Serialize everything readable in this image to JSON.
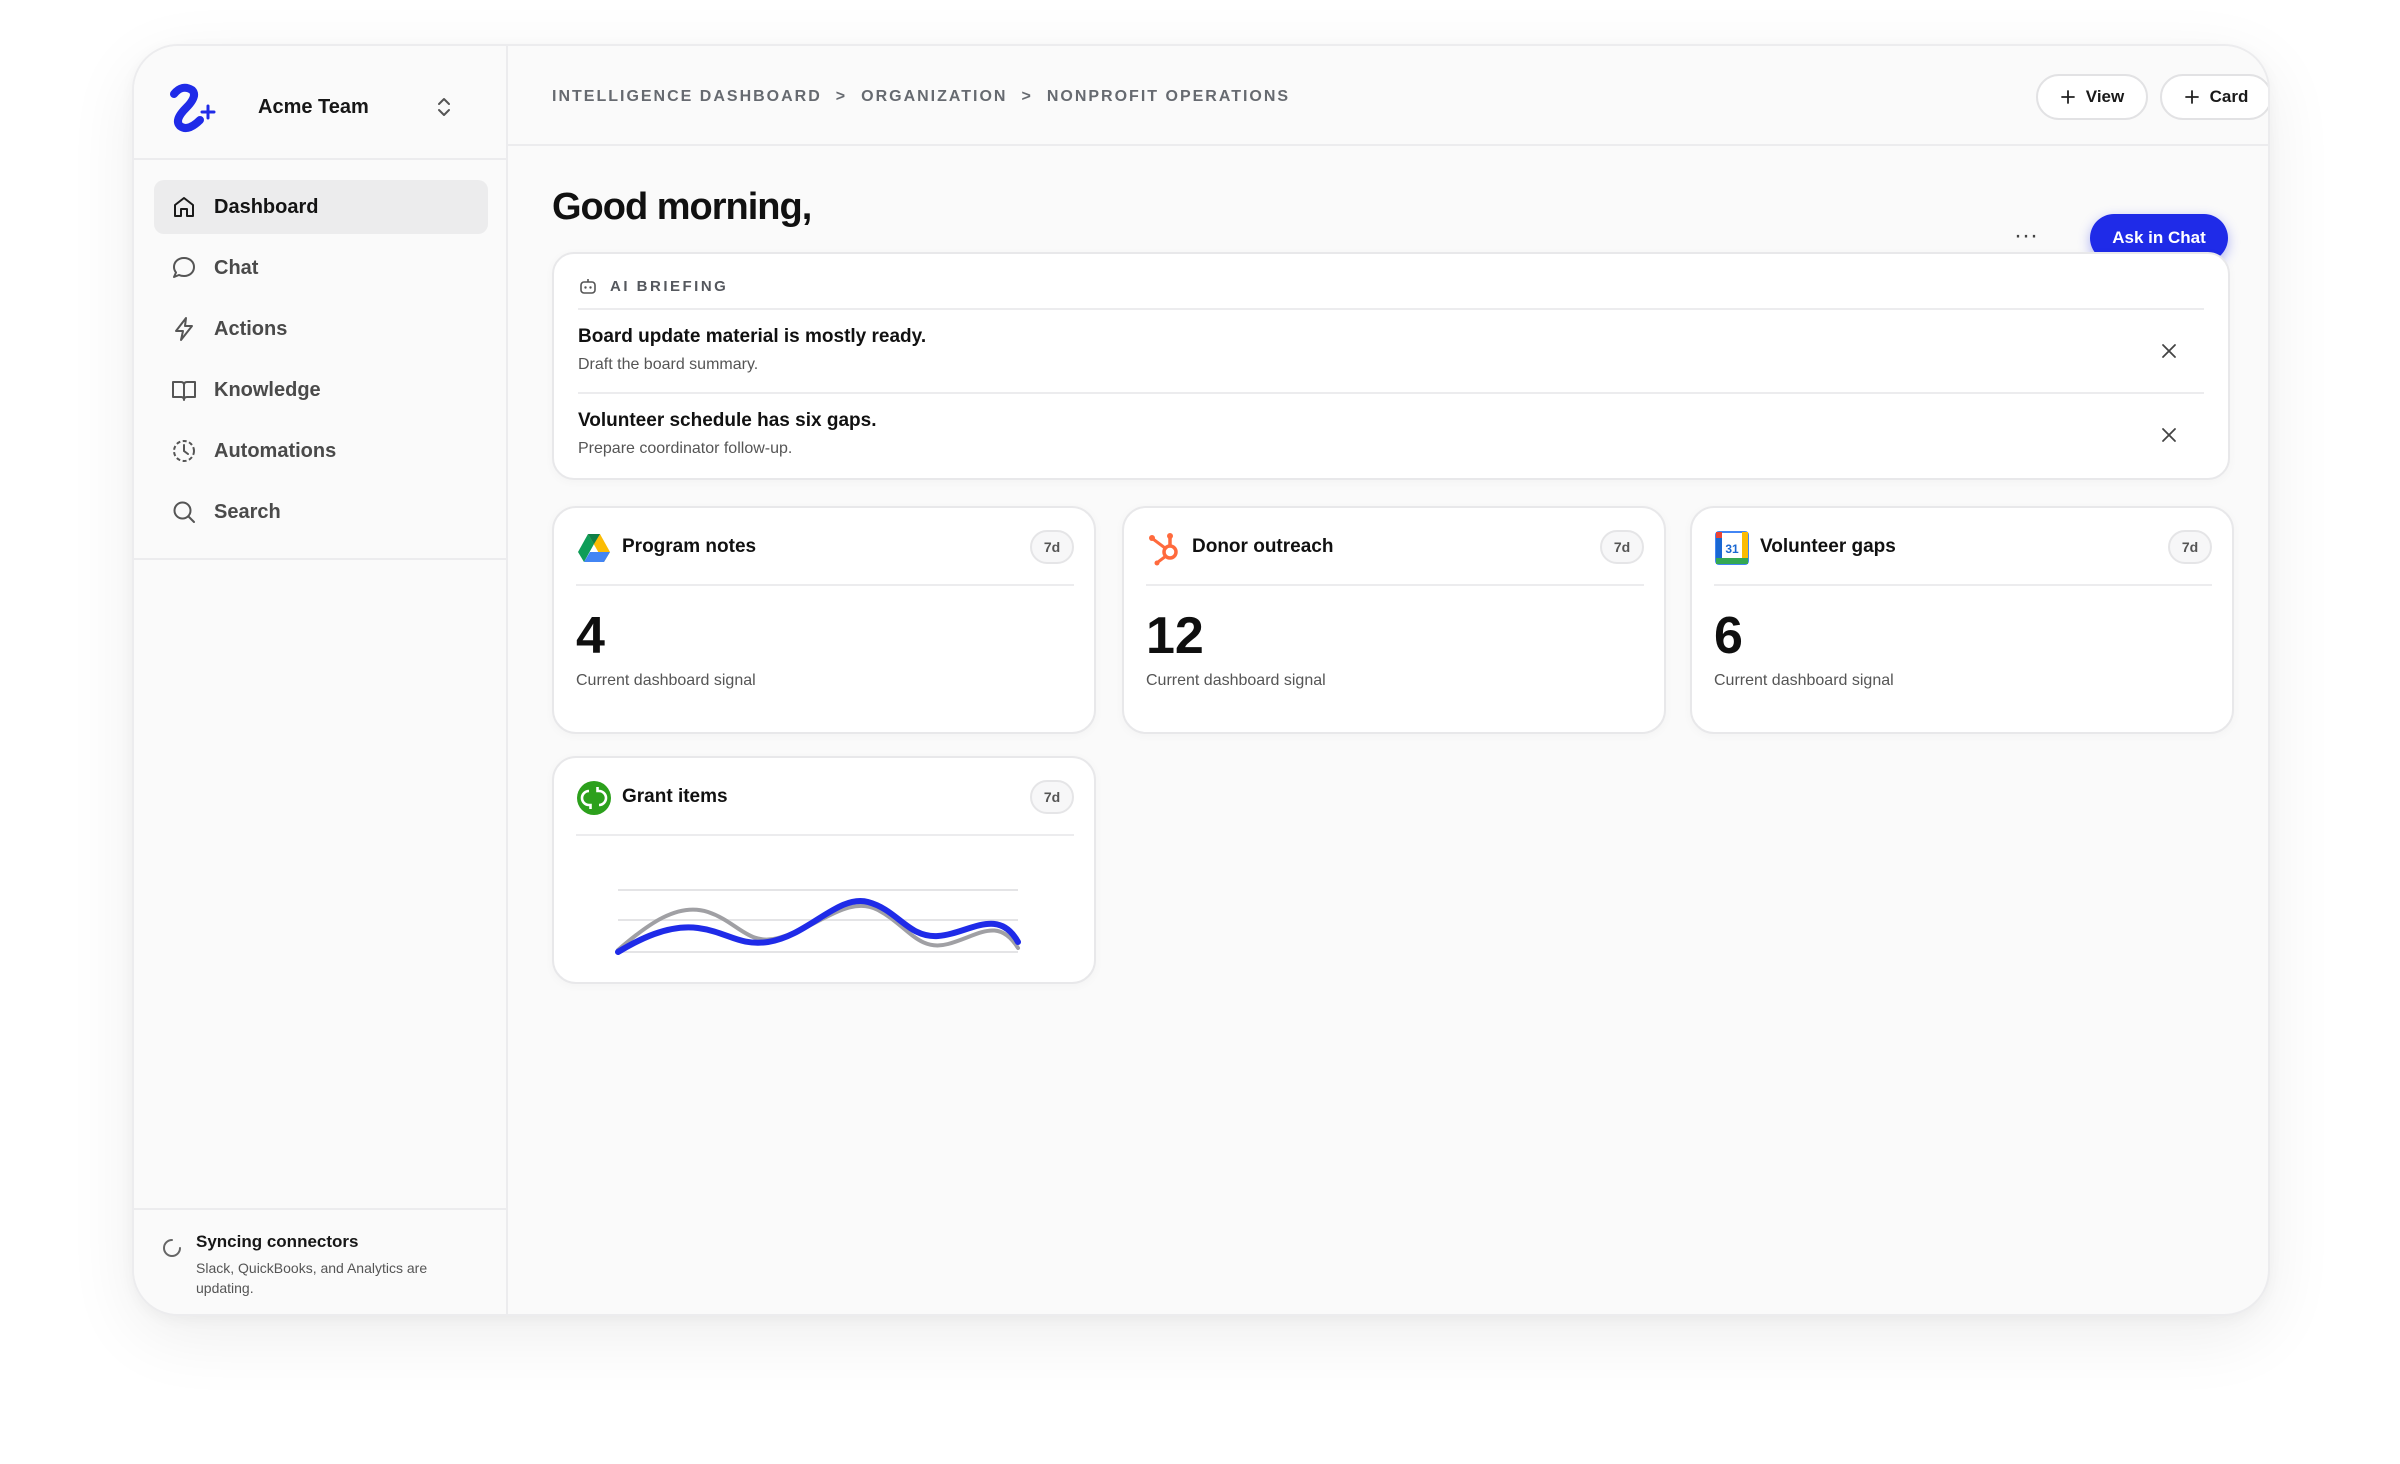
{
  "team": {
    "name": "Acme Team"
  },
  "nav": [
    {
      "label": "Dashboard",
      "icon": "home-icon",
      "active": true
    },
    {
      "label": "Chat",
      "icon": "chat-bubble-icon"
    },
    {
      "label": "Actions",
      "icon": "lightning-icon"
    },
    {
      "label": "Knowledge",
      "icon": "book-icon"
    },
    {
      "label": "Automations",
      "icon": "clock-icon"
    },
    {
      "label": "Search",
      "icon": "search-icon"
    }
  ],
  "sync": {
    "title": "Syncing connectors",
    "description": "Slack, QuickBooks, and Analytics are updating.",
    "icon": "spinner-icon"
  },
  "breadcrumb": [
    "INTELLIGENCE DASHBOARD",
    ">",
    "ORGANIZATION",
    ">",
    "NONPROFIT OPERATIONS"
  ],
  "toolbar": {
    "view_label": "View",
    "card_label": "Card"
  },
  "greeting": "Good morning,",
  "more_label": "···",
  "ask_label": "Ask in Chat",
  "briefing": {
    "heading": "AI BRIEFING",
    "items": [
      {
        "title": "Board update material is mostly ready.",
        "subtitle": "Draft the board summary."
      },
      {
        "title": "Volunteer schedule has six gaps.",
        "subtitle": "Prepare coordinator follow-up."
      }
    ]
  },
  "cards": [
    {
      "title": "Program notes",
      "badge": "7d",
      "value": "4",
      "caption": "Current dashboard signal",
      "icon": "google-drive-icon"
    },
    {
      "title": "Donor outreach",
      "badge": "7d",
      "value": "12",
      "caption": "Current dashboard signal",
      "icon": "hubspot-icon"
    },
    {
      "title": "Volunteer gaps",
      "badge": "7d",
      "value": "6",
      "caption": "Current dashboard signal",
      "icon": "google-calendar-icon"
    },
    {
      "title": "Grant items",
      "badge": "7d",
      "icon": "quickbooks-icon"
    }
  ],
  "colors": {
    "accent": "#1f2be8",
    "secondary_series": "#a0a0a4"
  }
}
